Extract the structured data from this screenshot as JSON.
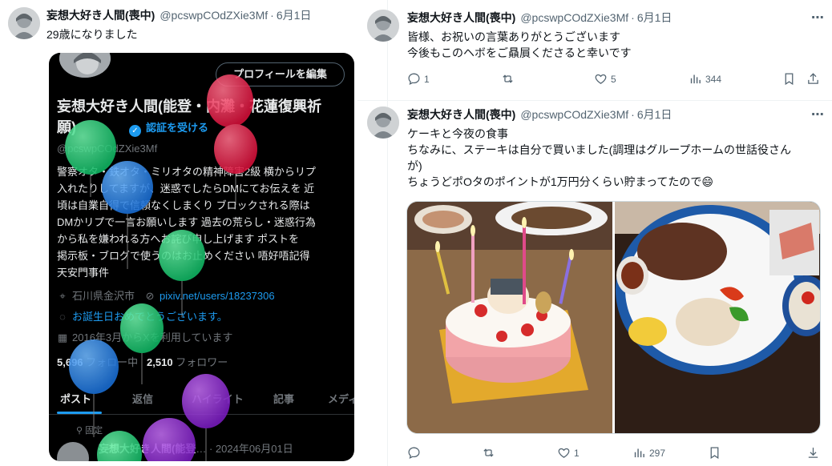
{
  "colors": {
    "accent": "#1d9bf0",
    "text": "#0f1419",
    "secondary": "#536471",
    "divider": "#eff3f4"
  },
  "left_tweet": {
    "author_name": "妄想大好き人間(喪中)",
    "handle": "@pcswpCOdZXie3Mf",
    "dot": "·",
    "date": "6月1日",
    "text": "29歳になりました",
    "profile_shot": {
      "edit_profile_button": "プロフィールを編集",
      "display_name": "妄想大好き人間(能登・内灘・花蓮復興祈願)",
      "verify_label": "認証を受ける",
      "verify_icon": "check-badge-icon",
      "handle": "@pcswpCOdZXie3Mf",
      "bio_lines": [
        "警察オタ・鉄オタ・ミリオタの精神障害2級 横からリプ",
        "入れたりしてますが、迷惑でしたらDMにてお伝えを 近",
        "頃は自業自得で信頼なくしまくり ブロックされる際は",
        "DMかリプで一言お願いします 過去の荒らし・迷惑行為",
        "から私を嫌われる方へお詫び申し上げます ポストを",
        "掲示板・ブログで使うのはお止めください 唔好唔記得",
        "天安門事件"
      ],
      "location": "石川県金沢市",
      "website": "pixiv.net/users/18237306",
      "birthday": "お誕生日おめでとうございます。",
      "joined": "2016年3月からXを利用しています",
      "following_count": "5,696",
      "following_label": "フォロー中",
      "followers_count": "2,510",
      "followers_label": "フォロワー",
      "tabs": [
        "ポスト",
        "返信",
        "ハイライト",
        "記事",
        "メディ"
      ],
      "pinned_label": "固定",
      "pinned_name": "妄想大好き人間(能登",
      "pinned_date": "· 2024年06月01日"
    }
  },
  "right_tweet_1": {
    "author_name": "妄想大好き人間(喪中)",
    "handle": "@pcswpCOdZXie3Mf",
    "dot": "·",
    "date": "6月1日",
    "lines": [
      "皆様、お祝いの言葉ありがとうございます",
      "今後もこのヘボをご贔屓くださると幸いです"
    ],
    "reply_count": "1",
    "retweet_count": "",
    "like_count": "5",
    "view_count": "344"
  },
  "right_tweet_2": {
    "author_name": "妄想大好き人間(喪中)",
    "handle": "@pcswpCOdZXie3Mf",
    "dot": "·",
    "date": "6月1日",
    "lines": [
      "ケーキと今夜の食事",
      "ちなみに、ステーキは自分で買いました(調理はグループホームの世話役さん",
      "が)",
      "ちょうどポOタのポイントが1万円分くらい貯まってたので"
    ],
    "emoji": "😄",
    "cake_plate_text": "おたんじょうびおめでとう",
    "reply_count": "",
    "retweet_count": "",
    "like_count": "1",
    "view_count": "297"
  }
}
